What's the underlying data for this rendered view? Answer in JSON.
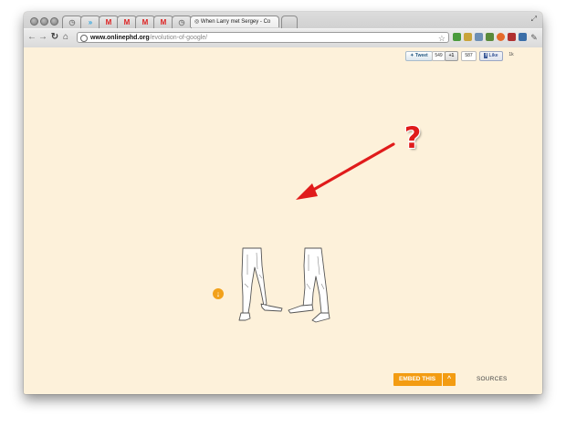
{
  "browser": {
    "tabs": [
      {
        "label": "",
        "icon": "history-icon",
        "kind": "plain"
      },
      {
        "label": "»",
        "icon": "twitter-icon",
        "kind": "twitter"
      },
      {
        "label": "M",
        "icon": "gmail-icon",
        "kind": "gmail"
      },
      {
        "label": "M",
        "icon": "gmail-icon",
        "kind": "gmail"
      },
      {
        "label": "M",
        "icon": "gmail-icon",
        "kind": "gmail"
      },
      {
        "label": "M",
        "icon": "gmail-icon",
        "kind": "gmail"
      },
      {
        "label": "",
        "icon": "history-icon",
        "kind": "plain"
      }
    ],
    "active_tab_title": "When Larry met Sergey - Co",
    "url_host": "www.onlinephd.org",
    "url_path": "/evolution-of-google/"
  },
  "social": {
    "tweet_label": "Tweet",
    "tweet_count": "549",
    "plusone_label": "+1",
    "plusone_count": "587",
    "like_label": "Like",
    "like_count": "1k"
  },
  "main": {
    "question_mark": "?",
    "scroll_down_glyph": "↓",
    "embed_label": "EMBED THIS",
    "embed_caret": "^",
    "sources_label": "SOURCES"
  },
  "colors": {
    "page_background": "#fdf1da",
    "accent_orange": "#f39c12",
    "arrow_red": "#e01b1b"
  }
}
